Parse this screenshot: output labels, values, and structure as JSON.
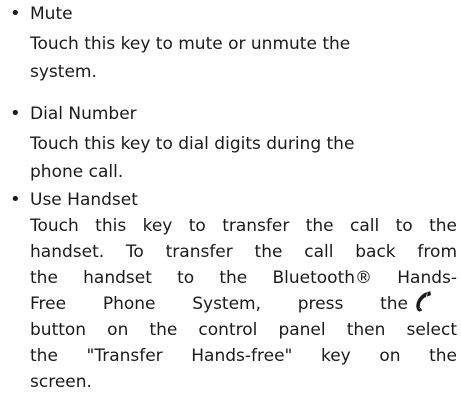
{
  "items": [
    {
      "term": "Mute",
      "lines": [
        "Touch this key to mute or unmute the",
        "system."
      ]
    },
    {
      "term": "Dial Number",
      "lines": [
        "Touch this key to dial digits during the",
        "phone call."
      ]
    },
    {
      "term": "Use Handset",
      "lines": [
        "Touch this key to transfer the call to the",
        "handset. To transfer the call back from",
        "the handset to the Bluetooth® Hands-",
        "Free Phone System, press the",
        "button on the control panel then select",
        "the \"Transfer Hands-free\" key on the",
        "screen."
      ]
    }
  ],
  "bullet": "•",
  "icons": {
    "phone": "phone-handset-icon"
  }
}
